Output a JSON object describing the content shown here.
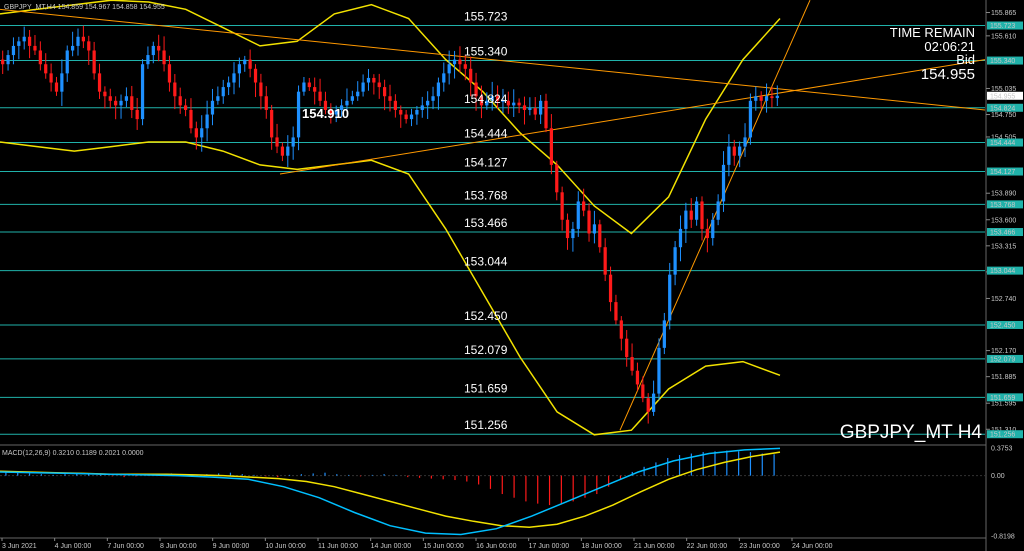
{
  "header": {
    "symbol_info": "GBPJPY_MT,H4 154.859 154.967 154.858 154.955"
  },
  "info_panel": {
    "time_label": "TIME REMAIN",
    "time_value": "02:06:21",
    "bid_label": "Bid",
    "bid_value": "154.955"
  },
  "watermark": "GBPJPY_MT H4",
  "current_price_label": "154.910",
  "macd": {
    "label": "MACD(12,26,9) 0.3210 0.1189 0.2021 0.0000",
    "axis_labels": [
      "0.3753",
      "0.00",
      "-0.8198"
    ]
  },
  "colors": {
    "bull": "#1e90ff",
    "bear": "#ff1a1a",
    "level_line": "#20b2aa",
    "envelope": "#f2e200",
    "trendline": "#ff9900",
    "macd_signal": "#f2e200",
    "macd_main": "#00bfff",
    "background": "#000000"
  },
  "chart_data": {
    "type": "candlestick",
    "symbol": "GBPJPY_MT",
    "timeframe": "H4",
    "price_axis": {
      "range": [
        151.16,
        155.98
      ],
      "ticks": [
        "155.865",
        "155.610",
        "155.035",
        "154.750",
        "154.505",
        "153.890",
        "153.600",
        "153.315",
        "153.030",
        "152.740",
        "152.170",
        "151.885",
        "151.595",
        "151.310"
      ]
    },
    "time_axis": {
      "labels": [
        "3 Jun 2021",
        "4 Jun 00:00",
        "7 Jun 00:00",
        "8 Jun 00:00",
        "9 Jun 00:00",
        "10 Jun 00:00",
        "11 Jun 00:00",
        "14 Jun 00:00",
        "15 Jun 00:00",
        "16 Jun 00:00",
        "17 Jun 00:00",
        "18 Jun 00:00",
        "21 Jun 00:00",
        "22 Jun 00:00",
        "23 Jun 00:00",
        "24 Jun 00:00"
      ]
    },
    "levels": [
      155.723,
      155.34,
      154.824,
      154.444,
      154.127,
      153.768,
      153.466,
      153.044,
      152.45,
      152.079,
      151.659,
      151.256
    ],
    "level_labels": [
      "155.723",
      "155.340",
      "154.824",
      "154.444",
      "154.127",
      "153.768",
      "153.466",
      "153.044",
      "152.450",
      "152.079",
      "151.659",
      "151.256"
    ],
    "current_price": 154.955,
    "candles_close": [
      155.3,
      155.4,
      155.5,
      155.55,
      155.6,
      155.5,
      155.45,
      155.3,
      155.2,
      155.1,
      155.0,
      155.2,
      155.45,
      155.5,
      155.6,
      155.55,
      155.45,
      155.2,
      155.0,
      154.95,
      154.9,
      154.85,
      154.9,
      154.95,
      154.8,
      154.7,
      155.3,
      155.4,
      155.5,
      155.45,
      155.3,
      155.1,
      154.95,
      154.85,
      154.8,
      154.6,
      154.5,
      154.6,
      154.75,
      154.9,
      154.95,
      155.05,
      155.1,
      155.2,
      155.3,
      155.35,
      155.25,
      155.1,
      154.95,
      154.8,
      154.5,
      154.4,
      154.3,
      154.4,
      154.5,
      155.0,
      155.1,
      155.05,
      155.0,
      154.9,
      154.8,
      154.75,
      154.8,
      154.85,
      154.9,
      154.95,
      155.0,
      155.1,
      155.15,
      155.1,
      155.05,
      154.95,
      154.9,
      154.8,
      154.75,
      154.7,
      154.75,
      154.8,
      154.85,
      154.9,
      154.95,
      155.1,
      155.2,
      155.3,
      155.35,
      155.3,
      155.25,
      155.1,
      154.95,
      154.85,
      154.9,
      154.95,
      154.9,
      154.9,
      154.85,
      154.88,
      154.85,
      154.8,
      154.82,
      154.75,
      154.9,
      154.6,
      154.2,
      153.9,
      153.6,
      153.4,
      153.5,
      153.8,
      153.7,
      153.45,
      153.55,
      153.3,
      153.0,
      152.7,
      152.5,
      152.3,
      152.1,
      151.95,
      151.8,
      151.65,
      151.5,
      151.7,
      152.2,
      152.5,
      153.0,
      153.3,
      153.5,
      153.7,
      153.6,
      153.8,
      153.5,
      153.4,
      153.6,
      153.8,
      154.2,
      154.4,
      154.3,
      154.4,
      154.5,
      154.9,
      154.95,
      154.9,
      154.95,
      154.93,
      154.955
    ],
    "envelope_upper": [
      155.85,
      155.9,
      155.95,
      156.0,
      155.98,
      155.9,
      155.7,
      155.5,
      155.55,
      155.85,
      155.95,
      155.8,
      155.35,
      155.0,
      154.55,
      154.2,
      153.75,
      153.45,
      153.85,
      154.7,
      155.35,
      155.8
    ],
    "envelope_lower": [
      154.45,
      154.4,
      154.35,
      154.4,
      154.45,
      154.45,
      154.35,
      154.2,
      154.15,
      154.2,
      154.25,
      154.1,
      153.5,
      152.8,
      152.1,
      151.5,
      151.25,
      151.3,
      151.75,
      152.0,
      152.05,
      151.9
    ],
    "macd_histogram": [
      0.05,
      0.04,
      0.03,
      0.02,
      0.01,
      0.02,
      0.03,
      0.02,
      0.01,
      -0.01,
      -0.02,
      -0.01,
      0.01,
      0.02,
      0.03,
      0.02,
      0.01,
      0.02,
      0.03,
      0.04,
      0.02,
      0.01,
      -0.01,
      -0.02,
      0.01,
      0.02,
      0.03,
      0.04,
      0.02,
      0.01,
      -0.01,
      0.01,
      0.02,
      0.01,
      -0.02,
      -0.03,
      -0.04,
      -0.05,
      -0.06,
      -0.08,
      -0.12,
      -0.18,
      -0.25,
      -0.3,
      -0.35,
      -0.38,
      -0.4,
      -0.38,
      -0.35,
      -0.3,
      -0.25,
      -0.15,
      -0.05,
      0.05,
      0.12,
      0.18,
      0.24,
      0.28,
      0.3,
      0.32,
      0.33,
      0.34,
      0.33,
      0.32,
      0.3,
      0.29
    ],
    "macd_signal": [
      0.06,
      0.05,
      0.04,
      0.03,
      0.02,
      0.02,
      0.02,
      0.01,
      0.0,
      -0.02,
      -0.04,
      -0.08,
      -0.15,
      -0.25,
      -0.35,
      -0.45,
      -0.55,
      -0.62,
      -0.68,
      -0.7,
      -0.66,
      -0.55,
      -0.4,
      -0.22,
      -0.05,
      0.08,
      0.18,
      0.26,
      0.32
    ],
    "macd_main": [
      0.05,
      0.04,
      0.03,
      0.02,
      0.01,
      0.0,
      -0.02,
      -0.05,
      -0.15,
      -0.3,
      -0.5,
      -0.68,
      -0.78,
      -0.8,
      -0.72,
      -0.55,
      -0.35,
      -0.15,
      0.05,
      0.2,
      0.3,
      0.35,
      0.37
    ]
  }
}
